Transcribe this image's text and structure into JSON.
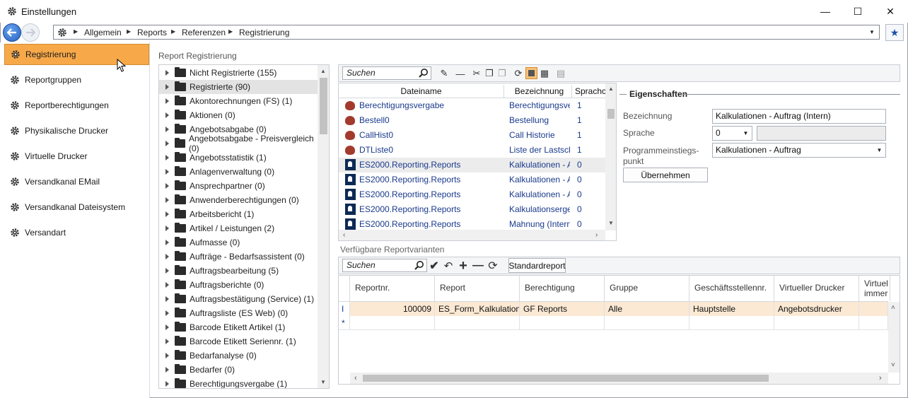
{
  "window": {
    "title": "Einstellungen",
    "minimize": "—",
    "maximize": "☐",
    "close": "✕"
  },
  "breadcrumb": [
    "Allgemein",
    "Reports",
    "Referenzen",
    "Registrierung"
  ],
  "sidebar": {
    "items": [
      {
        "label": "Registrierung",
        "active": true
      },
      {
        "label": "Reportgruppen"
      },
      {
        "label": "Reportberechtigungen"
      },
      {
        "label": "Physikalische Drucker"
      },
      {
        "label": "Virtuelle Drucker"
      },
      {
        "label": "Versandkanal EMail"
      },
      {
        "label": "Versandkanal Dateisystem"
      },
      {
        "label": "Versandart"
      }
    ]
  },
  "tree": {
    "label": "Report Registrierung",
    "items": [
      "Nicht Registrierte (155)",
      "Registrierte (90)",
      "Akontorechnungen (FS) (1)",
      "Aktionen (0)",
      "Angebotsabgabe (0)",
      "Angebotsabgabe - Preisvergleich (0)",
      "Angebotsstatistik (1)",
      "Anlagenverwaltung (0)",
      "Ansprechpartner (0)",
      "Anwenderberechtigungen (0)",
      "Arbeitsbericht (1)",
      "Artikel / Leistungen (2)",
      "Aufmasse (0)",
      "Aufträge - Bedarfsassistent (0)",
      "Auftragsbearbeitung (5)",
      "Auftragsberichte (0)",
      "Auftragsbestätigung (Service) (1)",
      "Auftragsliste (ES Web) (0)",
      "Barcode Etikett Artikel (1)",
      "Barcode Etikett Seriennr. (1)",
      "Bedarfanalyse (0)",
      "Bedarfer (0)",
      "Berechtigungsvergabe (1)"
    ],
    "selected_index": 1
  },
  "toolbar": {
    "search_placeholder": "Suchen"
  },
  "files": {
    "headers": [
      "Dateiname",
      "Bezeichnung",
      "Sprachco"
    ],
    "rows": [
      {
        "name": "Berechtigungsvergabe",
        "desc": "Berechtigungsver",
        "lang": "1",
        "icon": "red"
      },
      {
        "name": "Bestell0",
        "desc": "Bestellung",
        "lang": "1",
        "icon": "red"
      },
      {
        "name": "CallHist0",
        "desc": "Call Historie",
        "lang": "1",
        "icon": "red"
      },
      {
        "name": "DTListe0",
        "desc": "Liste der Lastschr",
        "lang": "1",
        "icon": "red"
      },
      {
        "name": "ES2000.Reporting.Reports",
        "desc": "Kalkulationen - Au",
        "lang": "0",
        "icon": "report"
      },
      {
        "name": "ES2000.Reporting.Reports",
        "desc": "Kalkulationen - Au",
        "lang": "0",
        "icon": "report"
      },
      {
        "name": "ES2000.Reporting.Reports",
        "desc": "Kalkulationen - Au",
        "lang": "0",
        "icon": "report"
      },
      {
        "name": "ES2000.Reporting.Reports",
        "desc": "Kalkulationsergeb",
        "lang": "0",
        "icon": "report"
      },
      {
        "name": "ES2000.Reporting.Reports",
        "desc": "Mahnung (Intern)",
        "lang": "0",
        "icon": "report"
      }
    ]
  },
  "properties": {
    "title": "Eigenschaften",
    "bezeichnung_label": "Bezeichnung",
    "bezeichnung_value": "Kalkulationen - Auftrag (Intern)",
    "sprache_label": "Sprache",
    "sprache_value": "0",
    "programm_label_1": "Programmeinstiegs-",
    "programm_label_2": "punkt",
    "programm_value": "Kalkulationen - Auftrag",
    "apply_button": "Übernehmen"
  },
  "variants": {
    "label": "Verfügbare Reportvarianten",
    "search_placeholder": "Suchen",
    "standard_button": "Standardreport",
    "headers": [
      "Reportnr.",
      "Report",
      "Berechtigung",
      "Gruppe",
      "Geschäftsstellennr.",
      "Virtueller Drucker",
      "Virtuel",
      "immer"
    ],
    "row": {
      "reportnr": "100009",
      "report": "ES_Form_Kalkulation...",
      "berechtigung": "GF Reports",
      "gruppe": "Alle",
      "geschaeftsstelle": "Hauptstelle",
      "drucker": "Angebotsdrucker"
    },
    "row_marker": "I",
    "new_marker": "*"
  },
  "colors": {
    "accent": "#f7a94a",
    "selection_row": "#fbe9d4",
    "link": "#1a3a8c"
  }
}
